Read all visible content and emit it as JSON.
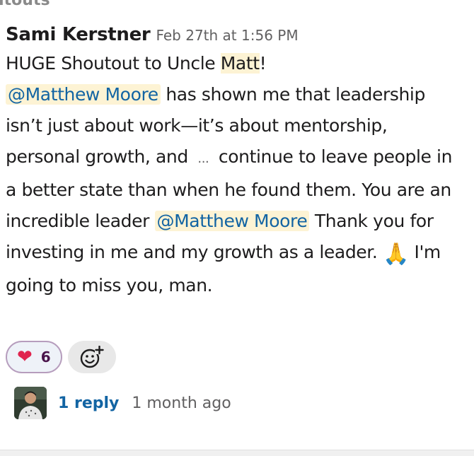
{
  "channel": {
    "title_fragment": "utouts"
  },
  "message": {
    "author": "Sami Kerstner",
    "timestamp": "Feb 27th at 1:56 PM",
    "line1_text": "HUGE Shoutout to Uncle ",
    "line1_highlight": "Matt",
    "line1_end": "!",
    "mention1": "@Matthew Moore",
    "text_after_mention1": " has shown me that leadership isn’t just about work—it’s about mentorship, personal growth, and ",
    "truncation": "...",
    "text_before_mention2": " continue to leave people in a better state than when he found them. You are an incredible leader ",
    "mention2": "@Matthew Moore",
    "text_after_mention2": " Thank you for investing in me and my growth as a leader. ",
    "emoji": "🙏",
    "text_end": " I'm going to miss you, man."
  },
  "reactions": [
    {
      "icon": "heart-icon",
      "emoji": "❤",
      "count": "6",
      "color": "#e0244e"
    }
  ],
  "add_reaction": {
    "icon": "add-reaction-icon"
  },
  "thread": {
    "reply_label": "1 reply",
    "time_label": "1 month ago"
  },
  "colors": {
    "mention_text": "#1264a3",
    "highlight_bg": "#fdf3d4",
    "reaction_border": "#b69dbd"
  }
}
